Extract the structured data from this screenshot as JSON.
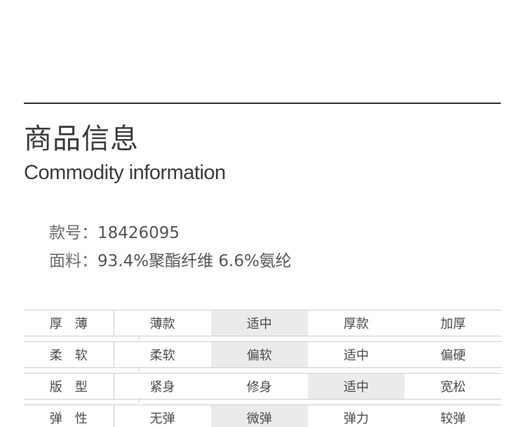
{
  "title": {
    "zh": "商品信息",
    "en": "Commodity information"
  },
  "info": {
    "sku_label": "款号：",
    "sku_value": "18426095",
    "fabric_label": "面料：",
    "fabric_value": "93.4%聚酯纤维 6.6%氨纶"
  },
  "specs": [
    {
      "name": "厚薄",
      "options": [
        "薄款",
        "适中",
        "厚款",
        "加厚"
      ],
      "selected_index": 1
    },
    {
      "name": "柔软",
      "options": [
        "柔软",
        "偏软",
        "适中",
        "偏硬"
      ],
      "selected_index": 1
    },
    {
      "name": "版型",
      "options": [
        "紧身",
        "修身",
        "适中",
        "宽松"
      ],
      "selected_index": 2
    },
    {
      "name": "弹性",
      "options": [
        "无弹",
        "微弹",
        "弹力",
        "较弹"
      ],
      "selected_index": 1
    }
  ],
  "colors": {
    "rule": "#2f2f2f",
    "table_line": "#cfcfcf",
    "selected_bg": "#ebebeb"
  }
}
